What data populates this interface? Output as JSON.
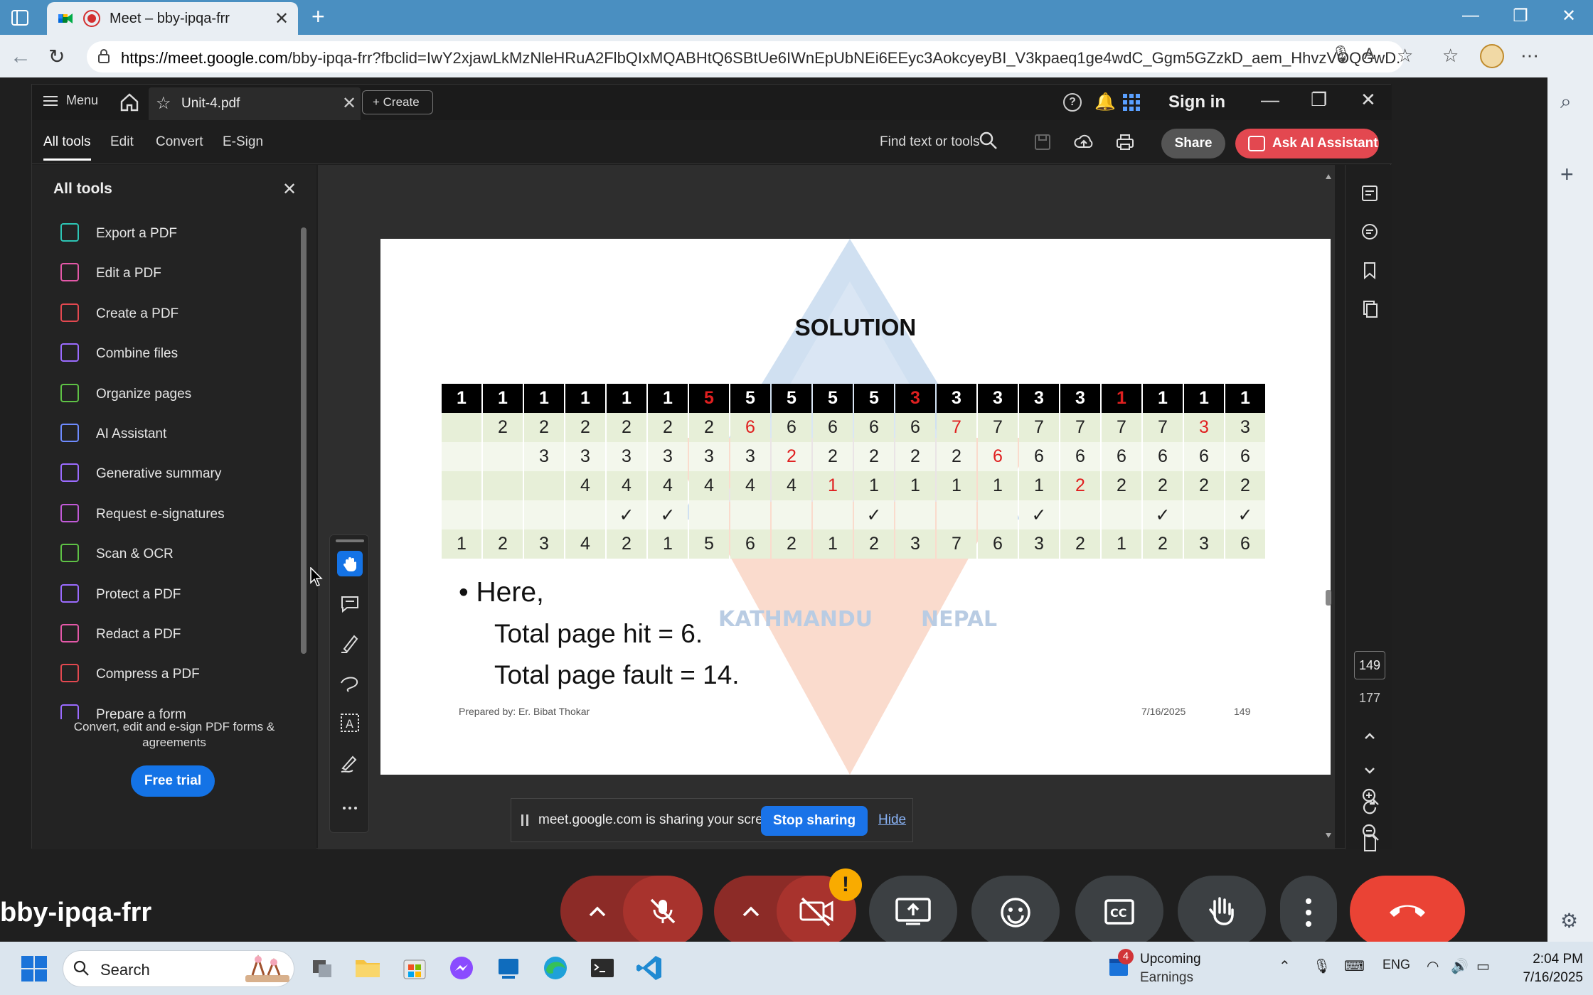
{
  "browser": {
    "tab_title": "Meet – bby-ipqa-frr",
    "url_host": "https://meet.google.com",
    "url_path": "/bby-ipqa-frr?fbclid=IwY2xjawLkMzNleHRuA2FlbQIxMQABHtQ6SBtUe6IWnEpUbNEi6EEyc3AokcyeyBI_V3kpaeq1ge4wdC_Ggm5GZzkD_aem_HhvzVOQGwD..."
  },
  "acrobat": {
    "menu_label": "Menu",
    "file_tab": "Unit-4.pdf",
    "create_label": "Create",
    "signin_label": "Sign in",
    "tabs": [
      "All tools",
      "Edit",
      "Convert",
      "E-Sign"
    ],
    "find_label": "Find text or tools",
    "share_label": "Share",
    "ai_label": "Ask AI Assistant",
    "panel_title": "All tools",
    "tools": [
      {
        "label": "Export a PDF",
        "color": "#2dc5b5"
      },
      {
        "label": "Edit a PDF",
        "color": "#e458a8"
      },
      {
        "label": "Create a PDF",
        "color": "#e34850"
      },
      {
        "label": "Combine files",
        "color": "#9b6bff"
      },
      {
        "label": "Organize pages",
        "color": "#5ec245"
      },
      {
        "label": "AI Assistant",
        "color": "#6e8bff"
      },
      {
        "label": "Generative summary",
        "color": "#9b6bff"
      },
      {
        "label": "Request e-signatures",
        "color": "#c25ad8"
      },
      {
        "label": "Scan & OCR",
        "color": "#5ec245"
      },
      {
        "label": "Protect a PDF",
        "color": "#9b6bff"
      },
      {
        "label": "Redact a PDF",
        "color": "#e458a8"
      },
      {
        "label": "Compress a PDF",
        "color": "#e34850"
      },
      {
        "label": "Prepare a form",
        "color": "#9b6bff"
      }
    ],
    "promo_text": "Convert, edit and e-sign PDF forms & agreements",
    "free_trial_label": "Free trial",
    "page_current": "149",
    "page_total": "177"
  },
  "slide": {
    "title": "SOLUTION",
    "reference_string": [
      "1",
      "1",
      "1",
      "1",
      "1",
      "1",
      "5",
      "5",
      "5",
      "5",
      "5",
      "3",
      "3",
      "3",
      "3",
      "3",
      "1",
      "1",
      "1",
      "1"
    ],
    "frame_rows": [
      [
        "",
        "2",
        "2",
        "2",
        "2",
        "2",
        "2",
        "6",
        "6",
        "6",
        "6",
        "6",
        "7",
        "7",
        "7",
        "7",
        "7",
        "7",
        "3",
        "3"
      ],
      [
        "",
        "",
        "3",
        "3",
        "3",
        "3",
        "3",
        "3",
        "2",
        "2",
        "2",
        "2",
        "2",
        "6",
        "6",
        "6",
        "6",
        "6",
        "6",
        "6"
      ],
      [
        "",
        "",
        "",
        "4",
        "4",
        "4",
        "4",
        "4",
        "4",
        "1",
        "1",
        "1",
        "1",
        "1",
        "1",
        "2",
        "2",
        "2",
        "2",
        "2"
      ],
      [
        "",
        "",
        "",
        "",
        "✓",
        "✓",
        "",
        "",
        "",
        "",
        "✓",
        "",
        "",
        "",
        "✓",
        "",
        "",
        "✓",
        "",
        "✓"
      ],
      [
        "1",
        "2",
        "3",
        "4",
        "2",
        "1",
        "5",
        "6",
        "2",
        "1",
        "2",
        "3",
        "7",
        "6",
        "3",
        "2",
        "1",
        "2",
        "3",
        "6"
      ]
    ],
    "red_cells": {
      "ref": [
        6,
        11,
        16
      ],
      "row0": [
        7,
        12,
        18
      ],
      "row1": [
        8,
        13
      ],
      "row2": [
        9,
        15
      ]
    },
    "bullet": "• Here,",
    "page_hit": "Total page hit = 6.",
    "page_fault": "Total page fault = 14.",
    "prepared_by": "Prepared by: Er. Bibat Thokar",
    "date": "7/16/2025",
    "page_number": "149",
    "watermark_left": "KATHMANDU",
    "watermark_right": "NEPAL"
  },
  "share_bar": {
    "text": "meet.google.com is sharing your screen.",
    "stop_label": "Stop sharing",
    "hide_label": "Hide"
  },
  "meet": {
    "meeting_code": "bby-ipqa-frr",
    "warning": "!"
  },
  "taskbar": {
    "search_label": "Search",
    "weather_badge": "4",
    "weather_line1": "Upcoming",
    "weather_line2": "Earnings",
    "language": "ENG",
    "time": "2:04 PM",
    "date": "7/16/2025"
  }
}
